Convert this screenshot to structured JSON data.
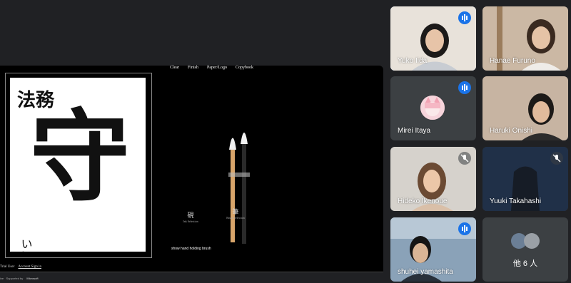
{
  "share": {
    "menu": [
      "Clear",
      "Finish",
      "Paper/Logo",
      "Copybook"
    ],
    "ink_label": "硯",
    "ink_sub": "Ink Selection",
    "brush_label": "筆",
    "brush_sub": "Brush Selection",
    "show_hand": "show hand holding brush",
    "calligraphy": {
      "left_top": "法務",
      "main": "守",
      "signature": "いいだ"
    },
    "footer_left": "Trial User",
    "footer_link": "Account Sign in",
    "footer_ver": "ive",
    "footer_supported": "Supported by",
    "footer_brand": "Microsoft"
  },
  "participants": [
    {
      "name": "Yuko Iida",
      "mic": "on",
      "active": true,
      "color": "#d9cfc2"
    },
    {
      "name": "Hanae Furuno",
      "mic": "none",
      "active": false,
      "color": "#c9b8a6"
    },
    {
      "name": "Mirei Itaya",
      "mic": "on",
      "active": false,
      "color": "#3c4043"
    },
    {
      "name": "Haruki Onishi",
      "mic": "none",
      "active": false,
      "color": "#c9b7a4"
    },
    {
      "name": "Hideko Ikenoue",
      "mic": "off",
      "active": false,
      "color": "#d8d3ce"
    },
    {
      "name": "Yuuki Takahashi",
      "mic": "off",
      "active": false,
      "color": "#24354b"
    },
    {
      "name": "shuhei yamashita",
      "mic": "on",
      "active": false,
      "color": "#7d95ad"
    }
  ],
  "others_label": "他 6 人"
}
